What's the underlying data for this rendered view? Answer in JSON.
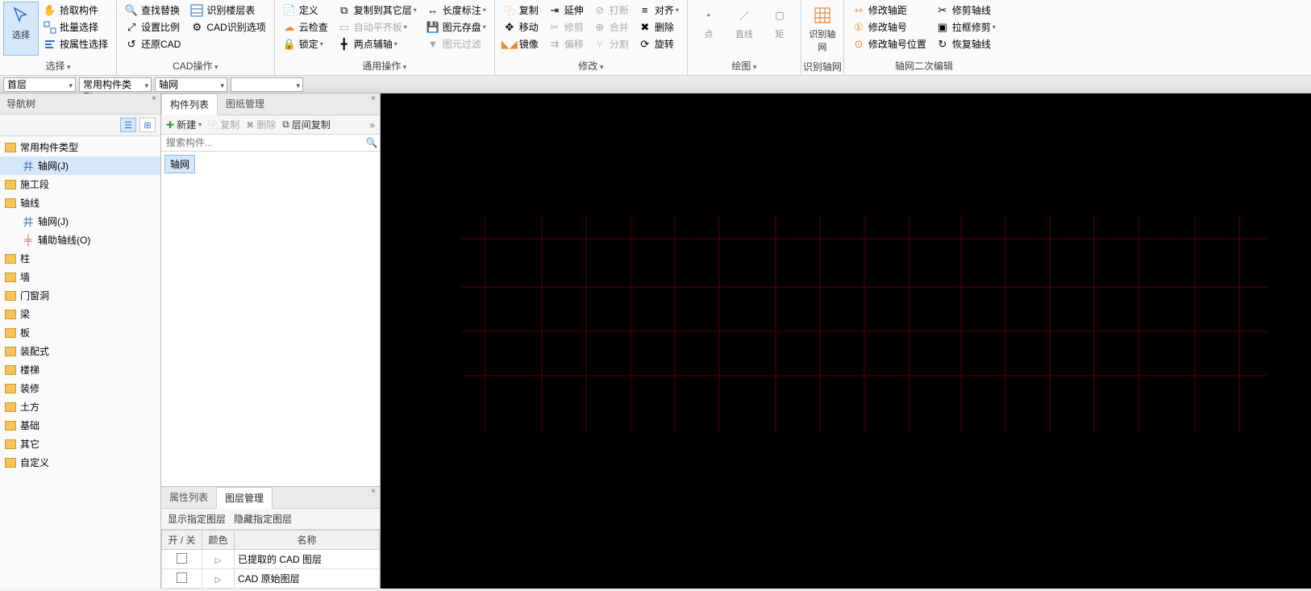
{
  "ribbon": {
    "select": {
      "label": "选择"
    },
    "pick": "拾取构件",
    "batch": "批量选择",
    "byprop": "按属性选择",
    "findreplace": "查找替换",
    "setscale": "设置比例",
    "restorecad": "还原CAD",
    "idfloor": "识别楼层表",
    "cadopt": "CAD识别选项",
    "group_cad": "CAD操作",
    "define": "定义",
    "cloudchk": "云检查",
    "lock": "锁定",
    "copyother": "复制到其它层",
    "autoflat": "自动平齐板",
    "twopt": "两点辅轴",
    "lendim": "长度标注",
    "imgstore": "图元存盘",
    "imgfilter": "图元过滤",
    "group_common": "通用操作",
    "copy": "复制",
    "move": "移动",
    "mirror": "镜像",
    "extend": "延伸",
    "trim": "修剪",
    "offset": "偏移",
    "break": "打断",
    "merge": "合并",
    "split": "分割",
    "align": "对齐",
    "delete": "删除",
    "rotate": "旋转",
    "group_edit": "修改",
    "point": "点",
    "line": "直线",
    "rec": "矩",
    "idgrid_big": "识别轴网",
    "group_draw": "绘图",
    "group_idgrid": "识别轴网",
    "modspacing": "修改轴距",
    "modnum": "修改轴号",
    "modnumpos": "修改轴号位置",
    "trimgrid": "修剪轴线",
    "boxtrim": "拉框修剪",
    "restoregrid": "恢复轴线",
    "group_gridedit": "轴网二次编辑"
  },
  "sub": {
    "floor": "首层",
    "comptype": "常用构件类型",
    "grid": "轴网"
  },
  "nav": {
    "title": "导航树",
    "items": [
      "常用构件类型",
      "轴网(J)",
      "施工段",
      "轴线",
      "轴网(J)",
      "辅助轴线(O)",
      "柱",
      "墙",
      "门窗洞",
      "梁",
      "板",
      "装配式",
      "楼梯",
      "装修",
      "土方",
      "基础",
      "其它",
      "自定义"
    ]
  },
  "mid": {
    "tab_comp": "构件列表",
    "tab_draw": "图纸管理",
    "new": "新建",
    "copy": "复制",
    "del": "删除",
    "layercopy": "层间复制",
    "search_ph": "搜索构件...",
    "item": "轴网"
  },
  "prop": {
    "tab_attr": "属性列表",
    "tab_layer": "图层管理",
    "show": "显示指定图层",
    "hide": "隐藏指定图层",
    "h_onoff": "开 / 关",
    "h_color": "颜色",
    "h_name": "名称",
    "row1": "已提取的 CAD 图层",
    "row2": "CAD 原始图层"
  }
}
